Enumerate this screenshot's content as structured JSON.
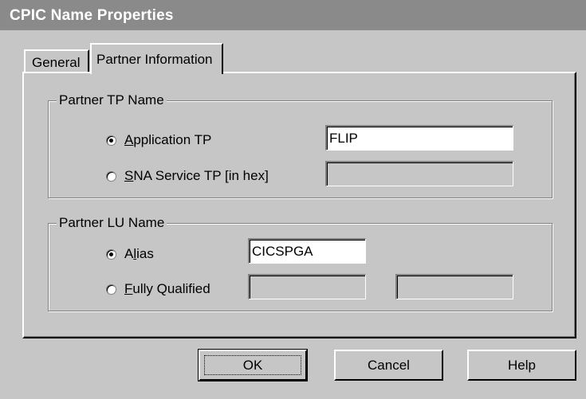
{
  "window": {
    "title": "CPIC Name Properties"
  },
  "tabs": [
    {
      "label": "General",
      "active": false
    },
    {
      "label": "Partner Information",
      "active": true
    }
  ],
  "partner_tp": {
    "legend": "Partner TP Name",
    "options": [
      {
        "mnemonic": "A",
        "rest": "pplication TP",
        "checked": true,
        "value": "FLIP"
      },
      {
        "mnemonic": "S",
        "rest": "NA Service TP [in hex]",
        "checked": false,
        "value": ""
      }
    ]
  },
  "partner_lu": {
    "legend": "Partner LU Name",
    "alias": {
      "prefix": "A",
      "mnemonic": "l",
      "rest": "ias",
      "checked": true,
      "value": "CICSPGA"
    },
    "fully_qualified": {
      "mnemonic": "F",
      "rest": "ully Qualified",
      "checked": false,
      "value1": "",
      "value2": ""
    }
  },
  "buttons": {
    "ok": "OK",
    "cancel": "Cancel",
    "help": "Help"
  }
}
